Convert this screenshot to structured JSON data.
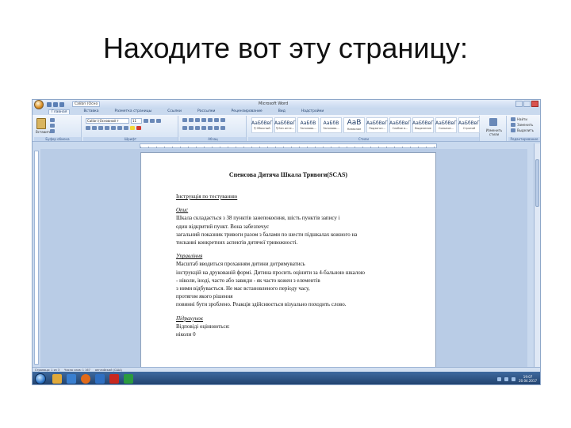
{
  "slide": {
    "title": "Находите вот эту страницу:"
  },
  "word": {
    "quick_access_font": "Calibri (Осно",
    "document_title": "Microsoft Word",
    "tabs": [
      "Главная",
      "Вставка",
      "Разметка страницы",
      "Ссылки",
      "Рассылки",
      "Рецензирование",
      "Вид",
      "Надстройки"
    ],
    "ribbon": {
      "paste_label": "Вставить",
      "clipboard_group": "Буфер обмена",
      "font_group": "Шрифт",
      "font_name": "Calibri (Основной т",
      "font_size": "11",
      "paragraph_group": "Абзац",
      "styles_group": "Стили",
      "styles": [
        {
          "sample": "АаБбВвГ",
          "name": "¶ Обычный"
        },
        {
          "sample": "АаБбВвГ",
          "name": "¶ Без инте..."
        },
        {
          "sample": "АаБбВ",
          "name": "Заголово..."
        },
        {
          "sample": "АаБбВ",
          "name": "Заголово..."
        },
        {
          "sample": "АаВ",
          "name": "Название"
        },
        {
          "sample": "АаБбВвГ",
          "name": "Подзагол..."
        },
        {
          "sample": "АаБбВвГ",
          "name": "Слабое в..."
        },
        {
          "sample": "АаБбВвГ",
          "name": "Выделение"
        },
        {
          "sample": "АаБбВвГ",
          "name": "Сильное..."
        },
        {
          "sample": "АаБбВвГ",
          "name": "Строгий"
        }
      ],
      "change_styles": "Изменить стили",
      "find": "Найти",
      "replace": "Заменить",
      "select": "Выделить",
      "editing_group": "Редактирование"
    },
    "document": {
      "heading": "Спенсова Дитяча Шкала Тривоги(SCAS)",
      "lines": [
        {
          "text": "Інструкція по тестуванню",
          "style": "uline"
        },
        {
          "text": "",
          "style": "gap"
        },
        {
          "text": "Опис",
          "style": "ital uline"
        },
        {
          "text": "Шкала складається з 38 пунктів занепокоєння, шість пунктів запису і",
          "style": ""
        },
        {
          "text": "один відкритий пункт. Вона забезпечує",
          "style": ""
        },
        {
          "text": "загальний показник тривоги разом з балами по шести підшкалах кожного на",
          "style": ""
        },
        {
          "text": "тисканні конкретних аспектів дитячої тривожності.",
          "style": ""
        },
        {
          "text": "",
          "style": "gap"
        },
        {
          "text": "Управління",
          "style": "ital uline"
        },
        {
          "text": "Масштаб вводиться проханням дитини дотримуватись",
          "style": ""
        },
        {
          "text": "інструкцій на друкованій формі. Дитина просить оцінити за 4-бальною шкалою",
          "style": ""
        },
        {
          "text": "- ніколи, іноді, часто або завжди - як часто кожен з елементів",
          "style": ""
        },
        {
          "text": "з ними відбувається. Не має встановленого періоду часу,",
          "style": ""
        },
        {
          "text": "протягом якого рішення",
          "style": ""
        },
        {
          "text": "повинні бути зроблено. Реакція здійснюється візуально походить слово.",
          "style": ""
        },
        {
          "text": "",
          "style": "gap"
        },
        {
          "text": "Підрахунок",
          "style": "ital uline"
        },
        {
          "text": "Відповіді оцінюються:",
          "style": ""
        },
        {
          "text": "ніколи        0",
          "style": ""
        }
      ]
    },
    "status": {
      "page": "Страница: 1 из 3",
      "words": "Число слов: 1 167",
      "language": "английский (США)"
    },
    "taskbar": {
      "time": "19:07",
      "date": "20.04.2017"
    }
  }
}
